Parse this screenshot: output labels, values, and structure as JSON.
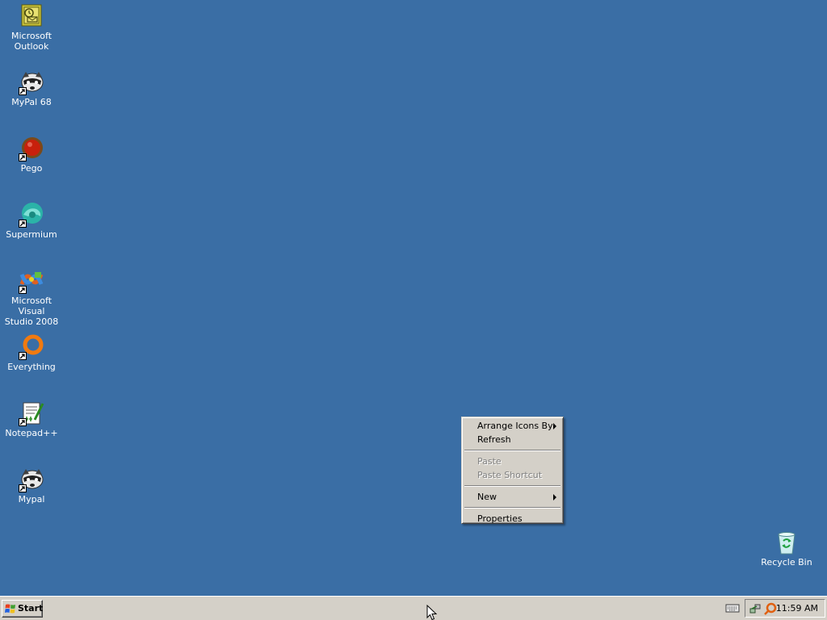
{
  "desktop": {
    "background_color": "#3a6ea5",
    "icons": [
      {
        "label_line1": "Microsoft",
        "label_line2": "Outlook",
        "icon": "outlook-icon"
      },
      {
        "label_line1": "MyPal 68",
        "label_line2": "",
        "icon": "raccoon-icon"
      },
      {
        "label_line1": "Pego",
        "label_line2": "",
        "icon": "pego-icon"
      },
      {
        "label_line1": "Supermium",
        "label_line2": "",
        "icon": "supermium-icon"
      },
      {
        "label_line1": "Microsoft Visual",
        "label_line2": "Studio 2008",
        "icon": "visual-studio-icon"
      },
      {
        "label_line1": "Everything",
        "label_line2": "",
        "icon": "everything-icon"
      },
      {
        "label_line1": "Notepad++",
        "label_line2": "",
        "icon": "notepad-plus-plus-icon"
      },
      {
        "label_line1": "Mypal",
        "label_line2": "",
        "icon": "raccoon-icon"
      },
      {
        "label_line1": "Recycle Bin",
        "label_line2": "",
        "icon": "recycle-bin-icon"
      }
    ]
  },
  "context_menu": {
    "items": [
      {
        "label": "Arrange Icons By",
        "enabled": true,
        "submenu": true
      },
      {
        "label": "Refresh",
        "enabled": true,
        "submenu": false
      },
      {
        "label": "Paste",
        "enabled": false,
        "submenu": false
      },
      {
        "label": "Paste Shortcut",
        "enabled": false,
        "submenu": false
      },
      {
        "label": "New",
        "enabled": true,
        "submenu": true
      },
      {
        "label": "Properties",
        "enabled": true,
        "submenu": false
      }
    ]
  },
  "taskbar": {
    "start_label": "Start",
    "clock": "11:59 AM",
    "tray_icons": [
      "keyboard-icon",
      "network-icon",
      "search-icon"
    ]
  }
}
